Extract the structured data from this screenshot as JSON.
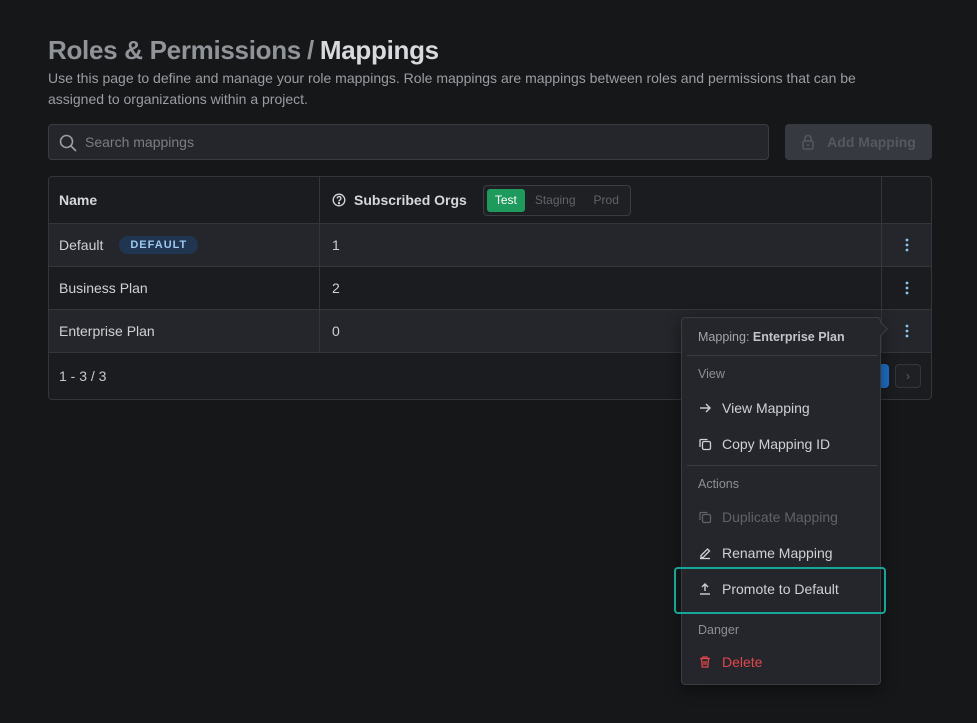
{
  "header": {
    "breadcrumb_parent": "Roles & Permissions",
    "separator": "/",
    "title": "Mappings",
    "description": "Use this page to define and manage your role mappings. Role mappings are mappings between roles and permissions that can be assigned to organizations within a project."
  },
  "toolbar": {
    "search_placeholder": "Search mappings",
    "search_value": "",
    "add_button_label": "Add Mapping",
    "add_button_icon": "lock-icon",
    "add_button_disabled": true
  },
  "table": {
    "columns": {
      "name": "Name",
      "subscribed_orgs": "Subscribed Orgs"
    },
    "environment_toggle": {
      "options": [
        "Test",
        "Staging",
        "Prod"
      ],
      "selected": "Test"
    },
    "rows": [
      {
        "name": "Default",
        "badge": "DEFAULT",
        "subscribed_orgs": "1"
      },
      {
        "name": "Business Plan",
        "badge": null,
        "subscribed_orgs": "2"
      },
      {
        "name": "Enterprise Plan",
        "badge": null,
        "subscribed_orgs": "0"
      }
    ],
    "pagination": {
      "range_text": "1 - 3 / 3",
      "next_label": "›"
    }
  },
  "context_menu": {
    "title_prefix": "Mapping:",
    "title_value": "Enterprise Plan",
    "sections": [
      {
        "label": "View",
        "items": [
          {
            "label": "View Mapping",
            "icon": "arrow-right-icon",
            "disabled": false
          },
          {
            "label": "Copy Mapping ID",
            "icon": "copy-icon",
            "disabled": false
          }
        ]
      },
      {
        "label": "Actions",
        "items": [
          {
            "label": "Duplicate Mapping",
            "icon": "duplicate-icon",
            "disabled": true
          },
          {
            "label": "Rename Mapping",
            "icon": "edit-icon",
            "disabled": false
          },
          {
            "label": "Promote to Default",
            "icon": "upload-icon",
            "disabled": false,
            "highlighted": true
          }
        ]
      },
      {
        "label": "Danger",
        "items": [
          {
            "label": "Delete",
            "icon": "trash-icon",
            "disabled": false,
            "danger": true
          }
        ]
      }
    ]
  },
  "colors": {
    "background": "#161719",
    "accent_green": "#1e9a5c",
    "accent_blue": "#1f6fc5",
    "highlight_teal": "#16a597",
    "danger_red": "#e0474c",
    "badge_bg": "#1f3550",
    "badge_text": "#9ec8ef"
  }
}
